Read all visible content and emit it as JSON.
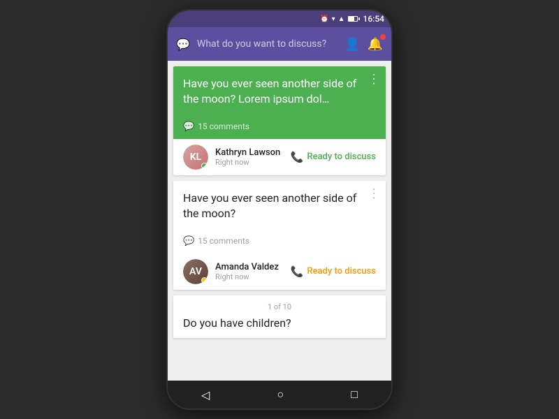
{
  "statusBar": {
    "time": "16:54",
    "icons": [
      "alarm",
      "wifi",
      "signal",
      "battery"
    ]
  },
  "topBar": {
    "placeholder": "What do you want to discuss?",
    "icons": [
      "account",
      "bell"
    ]
  },
  "cards": [
    {
      "id": "card-1",
      "type": "green",
      "title": "Have you ever seen another side of the moon? Lorem ipsum dol…",
      "commentsCount": "15 comments",
      "user": {
        "name": "Kathryn Lawson",
        "time": "Right now",
        "status": "green",
        "initials": "KL"
      },
      "readyLabel": "Ready to discuss",
      "readyColor": "green"
    },
    {
      "id": "card-2",
      "type": "white",
      "title": "Have you ever seen another side of the moon?",
      "commentsCount": "15 comments",
      "user": {
        "name": "Amanda Valdez",
        "time": "Right now",
        "status": "yellow",
        "initials": "AV"
      },
      "readyLabel": "Ready to discuss",
      "readyColor": "orange"
    }
  ],
  "thirdCard": {
    "pagination": "1 of 10",
    "title": "Do you have children?"
  },
  "bottomNav": {
    "back": "◁",
    "home": "○",
    "recent": "□"
  }
}
